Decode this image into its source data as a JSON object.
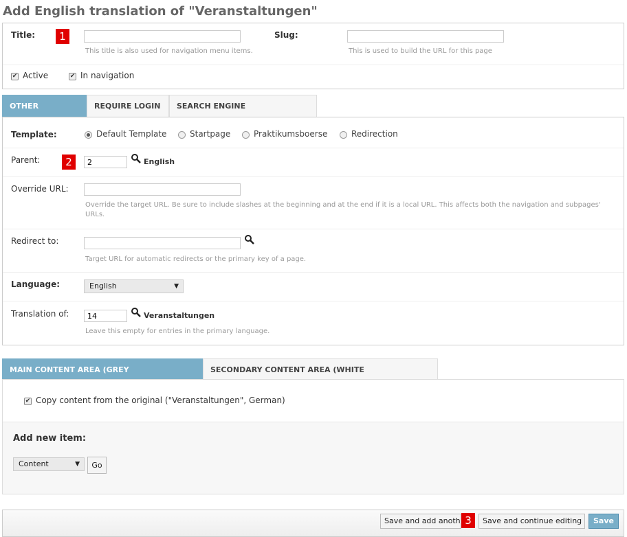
{
  "page_title": "Add English translation of \"Veranstaltungen\"",
  "markers": [
    "1",
    "2",
    "3"
  ],
  "basic": {
    "title_label": "Title:",
    "title_value": "",
    "title_help": "This title is also used for navigation menu items.",
    "slug_label": "Slug:",
    "slug_value": "",
    "slug_help": "This is used to build the URL for this page",
    "active_label": "Active",
    "in_navigation_label": "In navigation"
  },
  "option_tabs": [
    "OTHER OPTIONS",
    "REQUIRE LOGIN",
    "SEARCH ENGINE OPTIMIZATION"
  ],
  "options": {
    "template_label": "Template:",
    "templates": [
      "Default Template",
      "Startpage",
      "Praktikumsboerse",
      "Redirection"
    ],
    "selected_template": "Default Template",
    "parent_label": "Parent:",
    "parent_value": "2",
    "parent_lookup": "English",
    "override_label": "Override URL:",
    "override_value": "",
    "override_help": "Override the target URL. Be sure to include slashes at the beginning and at the end if it is a local URL. This affects both the navigation and subpages'",
    "override_help_2": "URLs.",
    "redirect_label": "Redirect to:",
    "redirect_value": "",
    "redirect_help": "Target URL for automatic redirects or the primary key of a page.",
    "language_label": "Language:",
    "language_value": "English",
    "translation_label": "Translation of:",
    "translation_value": "14",
    "translation_lookup": "Veranstaltungen",
    "translation_help": "Leave this empty for entries in the primary language."
  },
  "content_tabs": [
    "MAIN CONTENT AREA (GREY BACKGROUND)",
    "SECONDARY CONTENT AREA (WHITE BACKGROUND)"
  ],
  "content": {
    "copy_label": "Copy content from the original (\"Veranstaltungen\", German)",
    "add_item_label": "Add new item:",
    "item_type": "Content",
    "go_label": "Go"
  },
  "submit": {
    "save_add_another": "Save and add another",
    "save_continue": "Save and continue editing",
    "save": "Save"
  },
  "colors": {
    "accent": "#79aec8",
    "marker": "#e00000"
  },
  "icons": [
    "magnifier-icon",
    "checkbox-checked-icon",
    "chevron-down-icon"
  ]
}
